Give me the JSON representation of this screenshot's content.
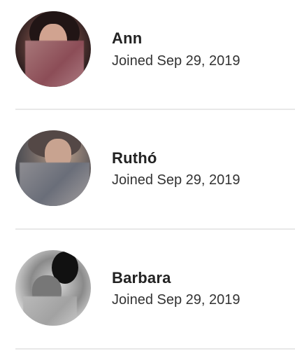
{
  "users": [
    {
      "name": "Ann",
      "joined": "Joined Sep 29, 2019"
    },
    {
      "name": "Ruthó",
      "joined": "Joined Sep 29, 2019"
    },
    {
      "name": "Barbara",
      "joined": "Joined Sep 29, 2019"
    }
  ]
}
